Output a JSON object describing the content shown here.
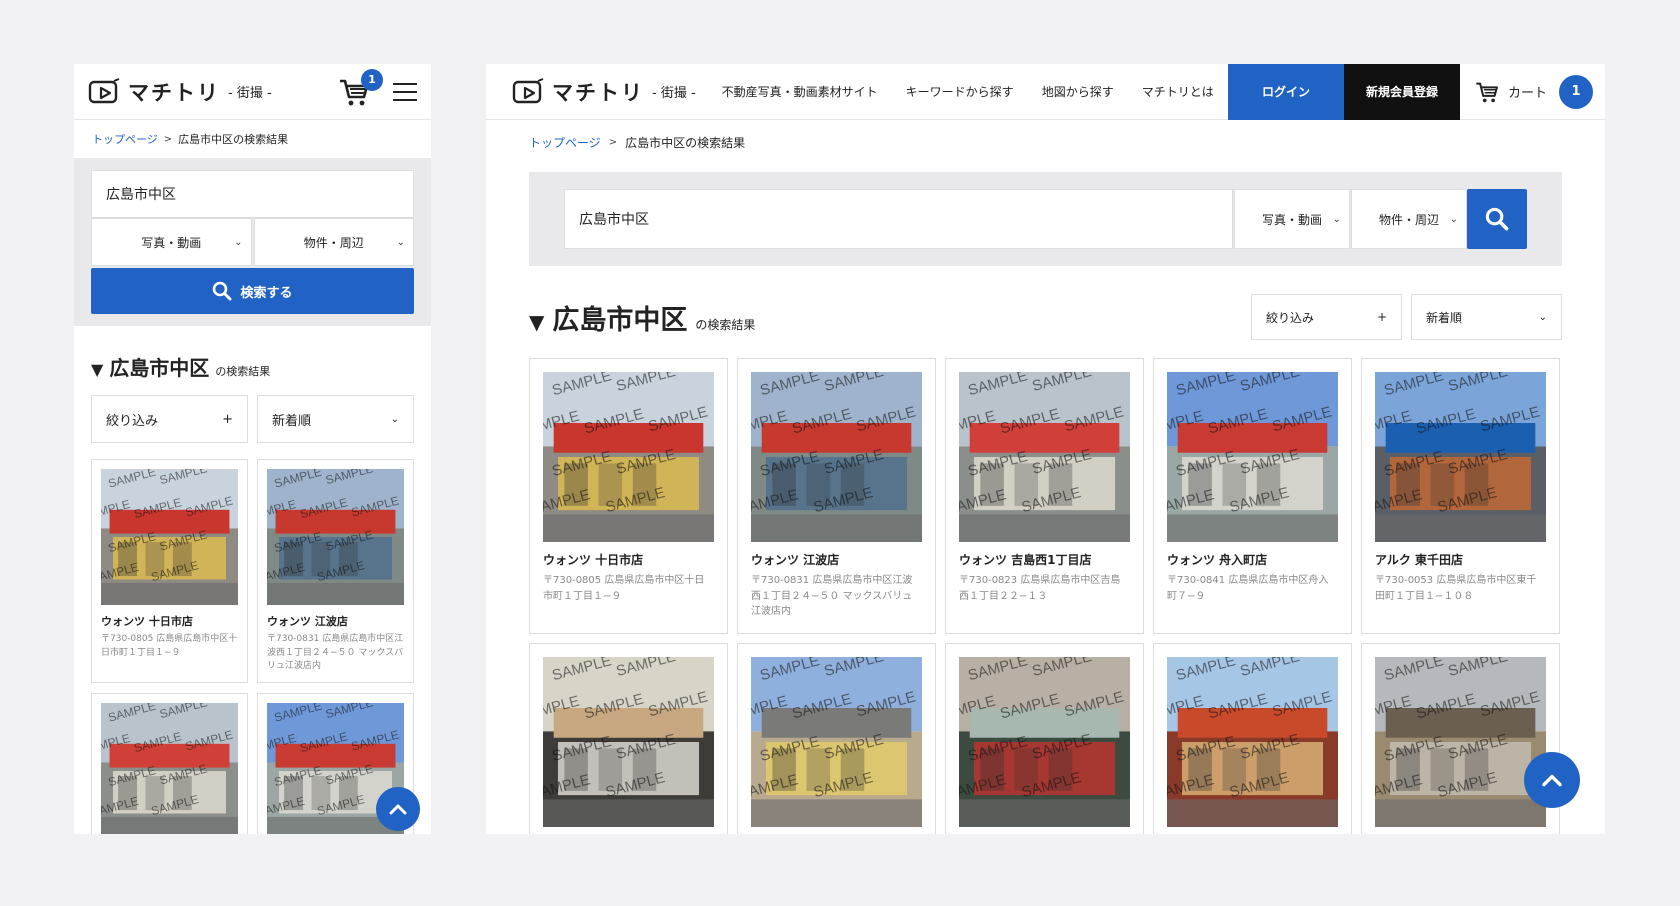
{
  "brand": {
    "name": "マチトリ",
    "sub": "- 街撮 -"
  },
  "mobile": {
    "cart_count": "1",
    "breadcrumb": {
      "home": "トップページ",
      "current": "広島市中区の検索結果"
    },
    "search": {
      "value": "広島市中区",
      "type_select": "写真・動画",
      "scope_select": "物件・周辺",
      "button": "検索する"
    },
    "result_title": {
      "query": "広島市中区",
      "suffix": "の検索結果"
    },
    "filter_label": "絞り込み",
    "sort_label": "新着順",
    "cards": [
      {
        "name": "ウォンツ 十日市店",
        "addr": "〒730-0805 広島県広島市中区十日市町１丁目１−９"
      },
      {
        "name": "ウォンツ 江波店",
        "addr": "〒730-0831 広島県広島市中区江波西１丁目２４−５０ マックスバリュ江波店内"
      },
      {
        "name": "",
        "addr": ""
      },
      {
        "name": "",
        "addr": ""
      }
    ]
  },
  "desktop": {
    "nav": [
      "不動産写真・動画素材サイト",
      "キーワードから探す",
      "地図から探す",
      "マチトリとは"
    ],
    "login": "ログイン",
    "register": "新規会員登録",
    "cart_label": "カート",
    "cart_count": "1",
    "breadcrumb": {
      "home": "トップページ",
      "current": "広島市中区の検索結果"
    },
    "search": {
      "value": "広島市中区",
      "type_select": "写真・動画",
      "scope_select": "物件・周辺"
    },
    "result_title": {
      "query": "広島市中区",
      "suffix": "の検索結果"
    },
    "filter_label": "絞り込み",
    "sort_label": "新着順",
    "cards": [
      {
        "name": "ウォンツ 十日市店",
        "addr": "〒730-0805 広島県広島市中区十日市町１丁目１−９"
      },
      {
        "name": "ウォンツ 江波店",
        "addr": "〒730-0831 広島県広島市中区江波西１丁目２４−５０ マックスバリュ江波店内"
      },
      {
        "name": "ウォンツ 吉島西1丁目店",
        "addr": "〒730-0823 広島県広島市中区吉島西１丁目２２−１３"
      },
      {
        "name": "ウォンツ 舟入町店",
        "addr": "〒730-0841 広島県広島市中区舟入町７−９"
      },
      {
        "name": "アルク 東千田店",
        "addr": "〒730-0053 広島県広島市中区東千田町１丁目１−１０８"
      },
      {
        "name": "",
        "addr": ""
      },
      {
        "name": "",
        "addr": ""
      },
      {
        "name": "",
        "addr": ""
      },
      {
        "name": "",
        "addr": ""
      },
      {
        "name": "",
        "addr": ""
      }
    ]
  },
  "watermark": "SAMPLE",
  "colors": {
    "accent": "#2163c4",
    "dark": "#111111",
    "panel": "#e9e9ec"
  },
  "icons": [
    "logo-play-icon",
    "cart-icon",
    "hamburger-icon",
    "chevron-right-icon",
    "chevron-down-icon",
    "search-icon",
    "plus-icon",
    "chevron-up-icon"
  ]
}
